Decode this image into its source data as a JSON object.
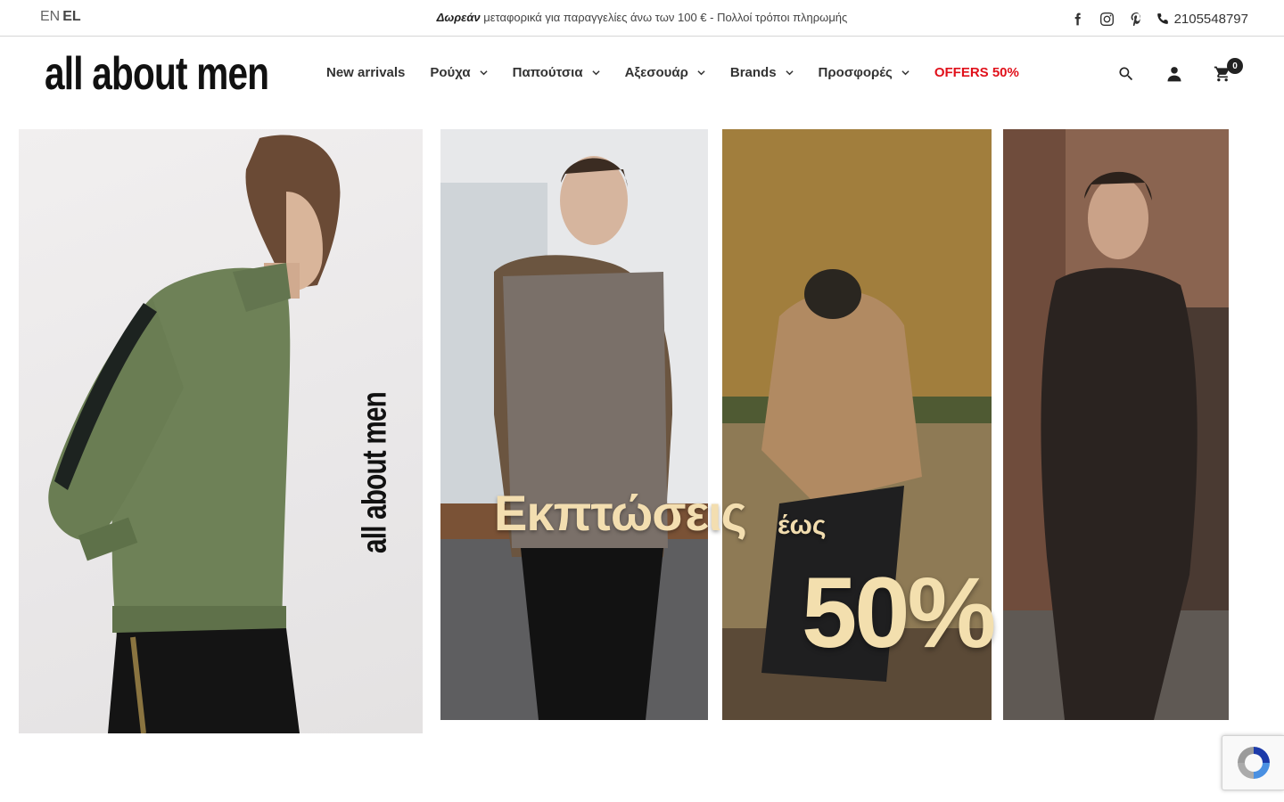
{
  "topbar": {
    "lang_inactive": "EN",
    "lang_active": "EL",
    "promo_bold": "Δωρεάν",
    "promo_rest": " μεταφορικά για παραγγελίες άνω των 100 € - Πολλοί τρόποι πληρωμής",
    "phone": "2105548797",
    "social_icons": [
      "facebook-icon",
      "instagram-icon",
      "pinterest-icon"
    ]
  },
  "header": {
    "logo_text": "all about men",
    "nav": [
      {
        "label": "New arrivals",
        "has_dropdown": false
      },
      {
        "label": "Ρούχα",
        "has_dropdown": true
      },
      {
        "label": "Παπούτσια",
        "has_dropdown": true
      },
      {
        "label": "Αξεσουάρ",
        "has_dropdown": true
      },
      {
        "label": "Brands",
        "has_dropdown": true
      },
      {
        "label": "Προσφορές",
        "has_dropdown": true
      },
      {
        "label": "OFFERS 50%",
        "has_dropdown": false
      }
    ],
    "cart_count": "0",
    "offers_color": "#e0101a"
  },
  "banners": {
    "left_logo": "all about men",
    "right_title": "Εκπτώσεις",
    "right_small": "έως",
    "right_big": "50%"
  }
}
